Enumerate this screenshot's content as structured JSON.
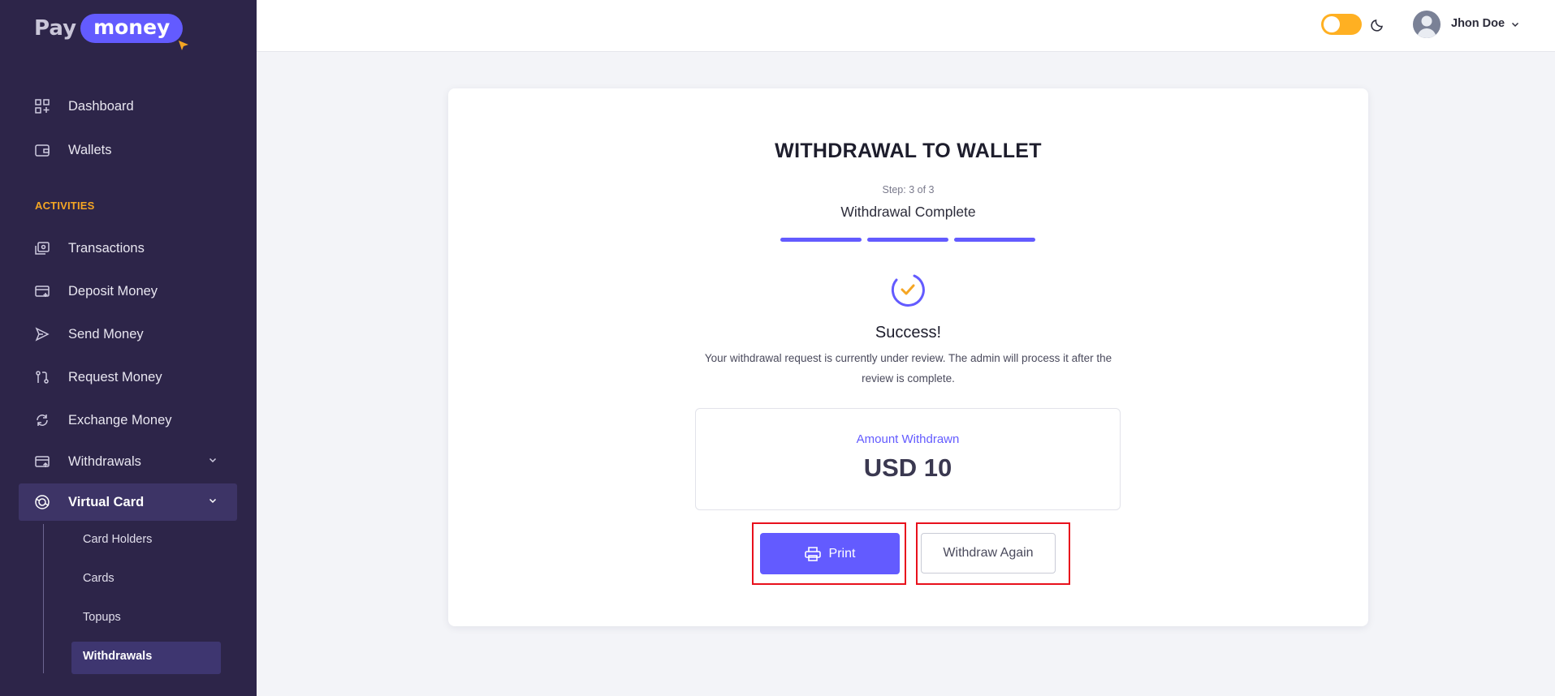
{
  "brand": {
    "part1": "Pay",
    "part2": "money"
  },
  "sidebar": {
    "items": [
      {
        "label": "Dashboard",
        "icon": "dashboard-icon"
      },
      {
        "label": "Wallets",
        "icon": "wallet-icon"
      }
    ],
    "section_title": "ACTIVITIES",
    "activities": [
      {
        "label": "Transactions",
        "icon": "transactions-icon"
      },
      {
        "label": "Deposit Money",
        "icon": "deposit-icon"
      },
      {
        "label": "Send Money",
        "icon": "send-icon"
      },
      {
        "label": "Request Money",
        "icon": "request-icon"
      },
      {
        "label": "Exchange Money",
        "icon": "exchange-icon"
      },
      {
        "label": "Withdrawals",
        "icon": "withdrawals-icon"
      }
    ],
    "virtual_card": {
      "label": "Virtual Card",
      "icon": "virtual-card-icon",
      "children": [
        "Card Holders",
        "Cards",
        "Topups",
        "Withdrawals"
      ],
      "active_child": "Withdrawals"
    }
  },
  "header": {
    "user_name": "Jhon Doe",
    "theme_toggle": "on"
  },
  "main": {
    "title": "WITHDRAWAL TO WALLET",
    "step": "Step: 3 of 3",
    "step_title": "Withdrawal Complete",
    "success_title": "Success!",
    "success_message": "Your withdrawal request is currently under review. The admin will process it after the review is complete.",
    "amount_label": "Amount Withdrawn",
    "amount_value": "USD 10",
    "print_label": "Print",
    "withdraw_again_label": "Withdraw Again"
  },
  "colors": {
    "sidebar_bg": "#2d2549",
    "accent": "#635bff",
    "section_title": "#f5a623",
    "toggle": "#ffb022",
    "highlight": "#e8101c"
  }
}
